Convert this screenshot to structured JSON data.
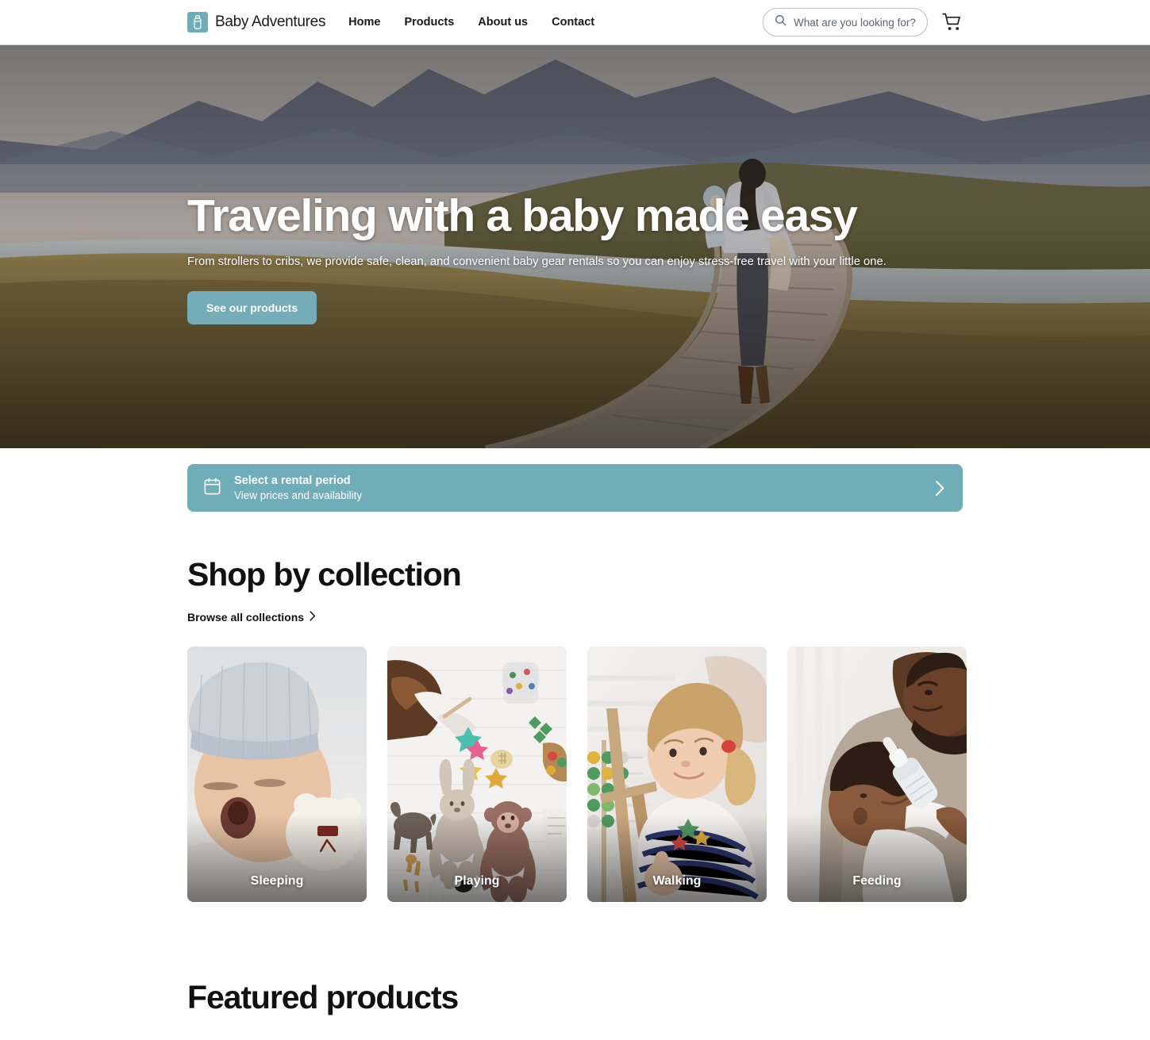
{
  "header": {
    "brand_name": "Baby Adventures",
    "logo_icon": "baby-bottle-icon",
    "nav": [
      {
        "label": "Home"
      },
      {
        "label": "Products"
      },
      {
        "label": "About us"
      },
      {
        "label": "Contact"
      }
    ],
    "search": {
      "placeholder": "What are you looking for?",
      "value": "",
      "icon": "search-icon"
    },
    "cart_icon": "shopping-cart-icon"
  },
  "hero": {
    "title": "Traveling with a baby made easy",
    "subtitle": "From strollers to cribs, we provide safe, clean, and convenient baby gear rentals so you can enjoy stress-free travel with your little one.",
    "cta_label": "See our products",
    "image_alt": "Woman carrying a baby walking along a wooden boardwalk through golden grassland with a lake and mountains"
  },
  "rental_banner": {
    "icon": "calendar-icon",
    "title": "Select a rental period",
    "subtitle": "View prices and availability",
    "chevron_icon": "chevron-right-icon"
  },
  "collections": {
    "heading": "Shop by collection",
    "browse_label": "Browse all collections",
    "browse_icon": "chevron-right-icon",
    "items": [
      {
        "label": "Sleeping",
        "image_alt": "Yawning newborn baby wearing a grey knit bobble hat next to a white teddy bear"
      },
      {
        "label": "Playing",
        "image_alt": "Overhead view of a toddler on a white play mat surrounded by plush animals and toys"
      },
      {
        "label": "Walking",
        "image_alt": "Blonde toddler in a navy striped shirt playing beside a wooden abacus"
      },
      {
        "label": "Feeding",
        "image_alt": "Father bottle-feeding his baby while holding them in his arms"
      }
    ]
  },
  "featured": {
    "heading": "Featured products"
  },
  "colors": {
    "accent_teal": "#6fadb9",
    "cta_teal": "#74adb8",
    "text_dark": "#111111",
    "border_grey": "#d4d4d4"
  }
}
